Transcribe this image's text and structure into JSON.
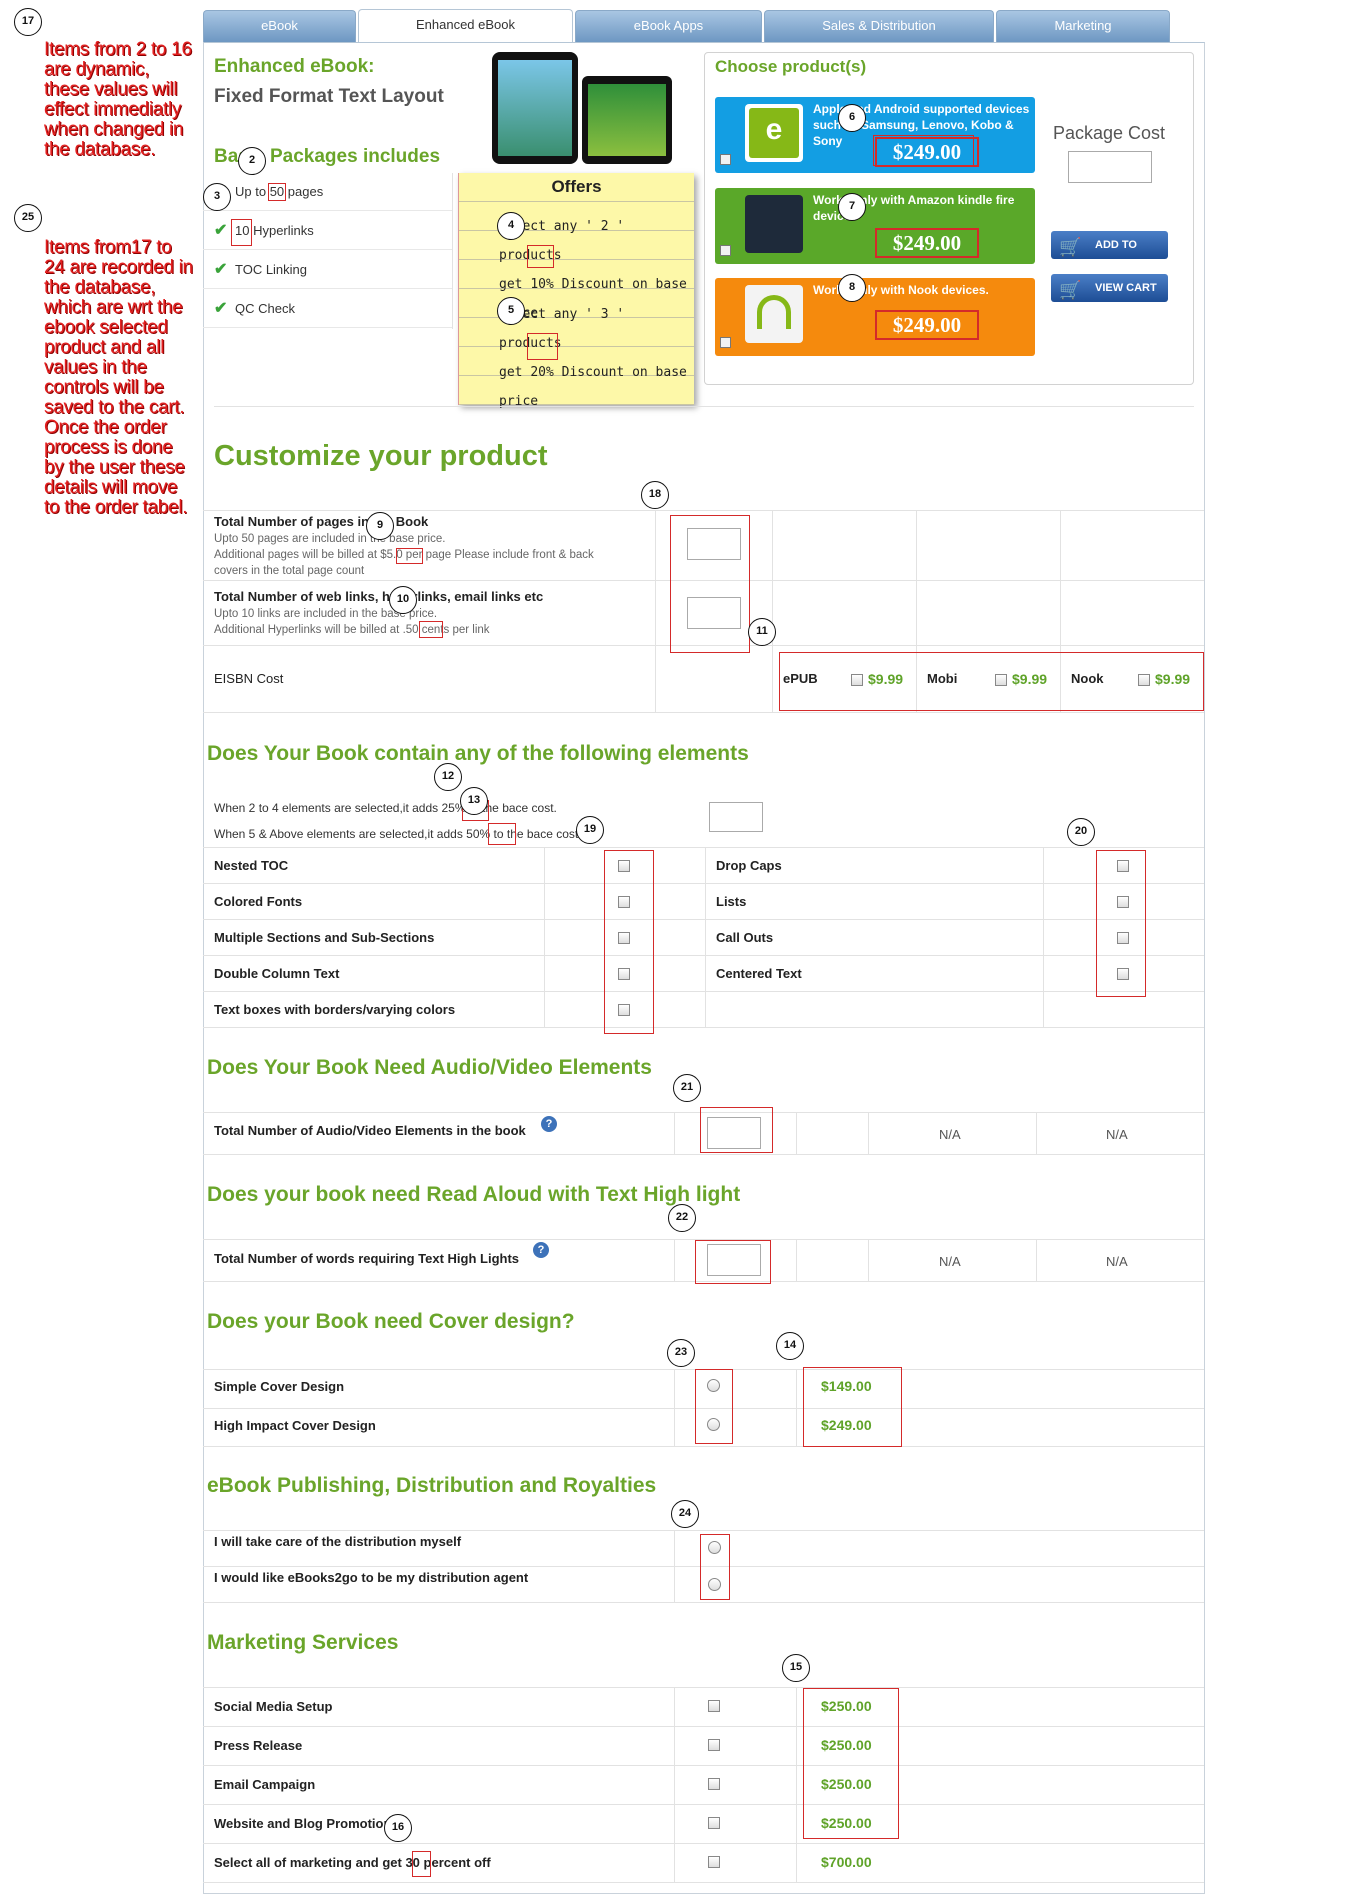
{
  "notes": {
    "note17": "Items from 2 to 16 are dynamic, these values will effect immediatly when changed in the database.",
    "note25": "Items from17 to 24 are recorded in the database, which are wrt the ebook selected product and all values in the controls will be saved to the cart. Once the order process is done by the user these details will move to the order tabel."
  },
  "tabs": [
    "eBook",
    "Enhanced eBook",
    "eBook Apps",
    "Sales & Distribution",
    "Marketing"
  ],
  "header": {
    "title": "Enhanced eBook:",
    "subtitle": "Fixed Format Text Layout",
    "packages_title": "Basic Packages includes"
  },
  "packages": [
    {
      "prefix": "Up to ",
      "value": "50",
      "suffix": " pages"
    },
    {
      "prefix": "",
      "value": "10",
      "suffix": " Hyperlinks"
    },
    {
      "prefix": "",
      "value": "",
      "suffix": "TOC Linking"
    },
    {
      "prefix": "",
      "value": "",
      "suffix": "QC Check"
    }
  ],
  "offers": {
    "title": "Offers",
    "offer1_a": "Select any ' 2 ' products",
    "offer1_b": "get ",
    "offer1_pct": "10%",
    "offer1_c": " Discount on base",
    "offer1_d": "price",
    "offer2_a": "Select any ' 3 ' products",
    "offer2_b": "get ",
    "offer2_pct": "20%",
    "offer2_c": " Discount on base",
    "offer2_d": "price"
  },
  "chooser": {
    "title": "Choose product(s)",
    "package_cost_label": "Package Cost",
    "add_to_cart": "ADD TO CART",
    "view_cart": "VIEW CART",
    "products": [
      {
        "logo": "ePub3",
        "desc": "Apple and Android supported devices such as Samsung, Lenovo, Kobo & Sony",
        "price": "$249.00",
        "color": "#139ee3"
      },
      {
        "logo": "kindle mobi",
        "desc": "Works only with Amazon kindle fire devices",
        "price": "$249.00",
        "color": "#5aa829"
      },
      {
        "logo": "nook",
        "desc": "Works only with Nook devices.",
        "price": "$249.00",
        "color": "#f58a0d"
      }
    ]
  },
  "customize": {
    "title": "Customize your product",
    "pages_label": "Total Number of pages in the Book",
    "pages_sub1": "Upto 50 pages are included in the base price.",
    "pages_sub2a": "Additional pages will be billed at ",
    "pages_price": "$5.0",
    "pages_sub2b": " per page Please include front & back",
    "pages_sub3": "covers in the total page count",
    "links_label": "Total Number of web links, hyperlinks, email links etc",
    "links_sub1": "Upto 10 links are included in the base price.",
    "links_sub2a": "Additional Hyperlinks will be billed at ",
    "links_price": ".50",
    "links_sub2b": " cents per link",
    "eisbn_label": "EISBN Cost",
    "eisbn": [
      {
        "name": "ePUB",
        "price": "$9.99"
      },
      {
        "name": "Mobi",
        "price": "$9.99"
      },
      {
        "name": "Nook",
        "price": "$9.99"
      }
    ]
  },
  "elements": {
    "title": "Does Your Book contain any of the following elements",
    "rule1a": "When 2 to 4 elements are selected,it adds ",
    "rule1_pct": "25%",
    "rule1b": " to the bace cost.",
    "rule2a": "When 5 & Above elements are selected,it adds ",
    "rule2_pct": "50%",
    "rule2b": " to the bace cost",
    "left": [
      "Nested TOC",
      "Colored Fonts",
      "Multiple Sections and Sub-Sections",
      "Double Column Text",
      "Text boxes with borders/varying colors"
    ],
    "right": [
      "Drop Caps",
      "Lists",
      "Call Outs",
      "Centered Text"
    ]
  },
  "audio": {
    "title": "Does Your Book Need Audio/Video Elements",
    "label": "Total Number of Audio/Video Elements in the book",
    "na1": "N/A",
    "na2": "N/A"
  },
  "readaloud": {
    "title": "Does your book need Read Aloud with Text High light",
    "label": "Total Number of words requiring Text High Lights",
    "na1": "N/A",
    "na2": "N/A"
  },
  "cover": {
    "title": "Does your Book need Cover design?",
    "options": [
      {
        "label": "Simple Cover Design",
        "price": "$149.00"
      },
      {
        "label": "High Impact Cover Design",
        "price": "$249.00"
      }
    ]
  },
  "distribution": {
    "title": "eBook Publishing, Distribution and Royalties",
    "options": [
      "I will take care of the distribution myself",
      "I would like eBooks2go to be my distribution agent"
    ]
  },
  "marketing": {
    "title": "Marketing Services",
    "items": [
      {
        "label": "Social Media Setup",
        "price": "$250.00"
      },
      {
        "label": "Press Release",
        "price": "$250.00"
      },
      {
        "label": "Email Campaign",
        "price": "$250.00"
      },
      {
        "label": "Website and Blog Promotion",
        "price": "$250.00"
      }
    ],
    "bundle_a": "Select all of marketing and get ",
    "bundle_pct": "30",
    "bundle_b": " percent off",
    "bundle_price": "$700.00"
  },
  "callouts": [
    "17",
    "25",
    "2",
    "3",
    "4",
    "5",
    "6",
    "7",
    "8",
    "9",
    "10",
    "11",
    "18",
    "12",
    "13",
    "19",
    "20",
    "21",
    "22",
    "23",
    "14",
    "24",
    "15",
    "16"
  ]
}
